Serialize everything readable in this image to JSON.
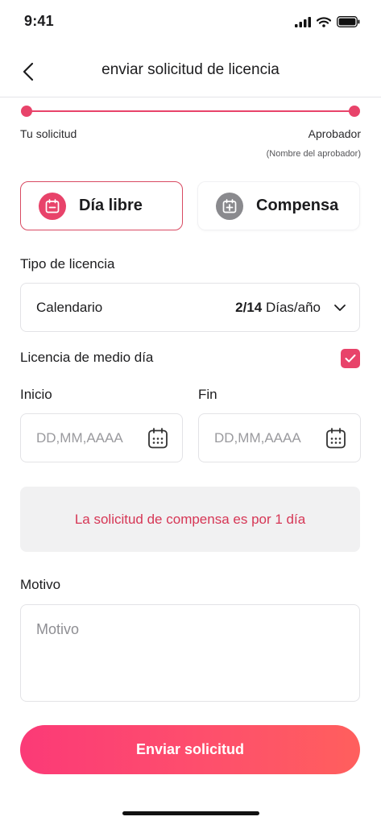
{
  "status_bar": {
    "time": "9:41"
  },
  "header": {
    "title": "enviar solicitud de licencia"
  },
  "progress": {
    "start_label": "Tu solicitud",
    "end_label": "Aprobador",
    "end_sublabel": "(Nombre del aprobador)"
  },
  "leave_types": [
    {
      "label": "Día libre",
      "icon": "calendar-minus-icon",
      "selected": true
    },
    {
      "label": "Compensa",
      "icon": "calendar-plus-icon",
      "selected": false
    }
  ],
  "leave_type_section": {
    "label": "Tipo de licencia",
    "selected_value": "Calendario",
    "count_used": "2/14",
    "count_unit": "Días/año"
  },
  "half_day": {
    "label": "Licencia de medio día",
    "checked": true
  },
  "dates": {
    "start_label": "Inicio",
    "end_label": "Fin",
    "start_placeholder": "DD,MM,AAAA",
    "end_placeholder": "DD,MM,AAAA"
  },
  "notice": {
    "text": "La solicitud de compensa es por 1 día"
  },
  "reason": {
    "label": "Motivo",
    "placeholder": "Motivo"
  },
  "submit": {
    "label": "Enviar solicitud"
  },
  "colors": {
    "accent": "#e8436a",
    "notice_text": "#d63655",
    "button_gradient_start": "#fb3a77",
    "button_gradient_end": "#ff5f5d"
  }
}
